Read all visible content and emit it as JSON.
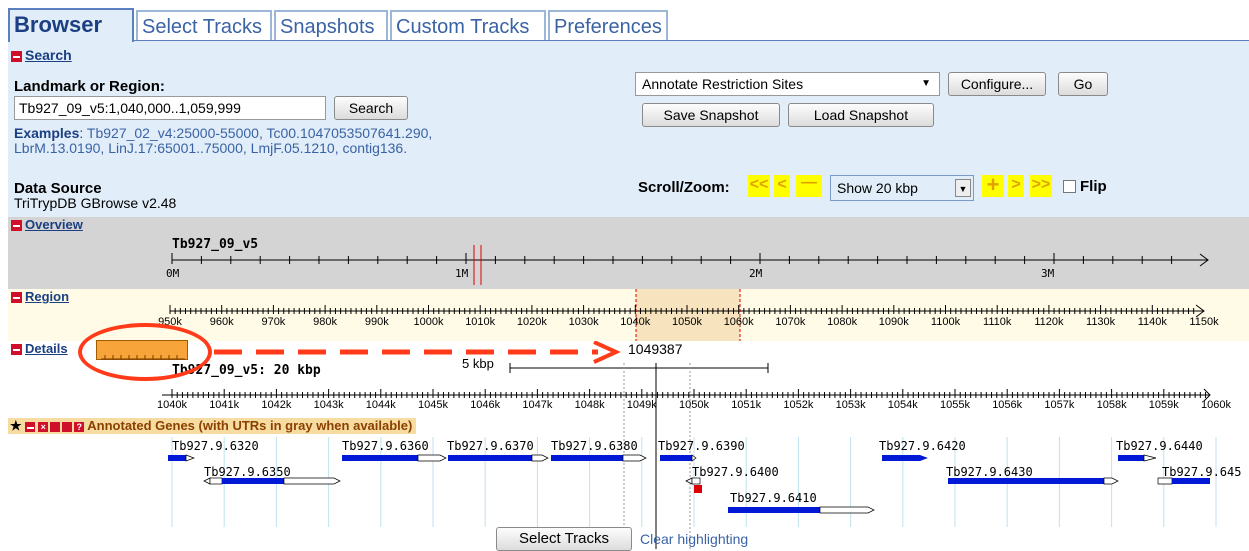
{
  "tabs": [
    {
      "label": "Browser"
    },
    {
      "label": "Select Tracks"
    },
    {
      "label": "Snapshots"
    },
    {
      "label": "Custom Tracks"
    },
    {
      "label": "Preferences"
    }
  ],
  "search": {
    "section": "Search",
    "landmark_label": "Landmark or Region:",
    "value": "Tb927_09_v5:1,040,000..1,059,999",
    "button": "Search",
    "examples_label": "Examples",
    "examples": [
      "Tb927_02_v4:25000-55000",
      "Tc00.1047053507641.290",
      "LbrM.13.0190",
      "LinJ.17:65001..75000",
      "LmjF.05.1210",
      "contig136."
    ]
  },
  "plugin": {
    "selected": "Annotate Restriction Sites",
    "configure": "Configure...",
    "go": "Go",
    "save_snapshot": "Save Snapshot",
    "load_snapshot": "Load Snapshot"
  },
  "datasource": {
    "label": "Data Source",
    "value": "TriTrypDB GBrowse v2.48"
  },
  "scrollzoom": {
    "label": "Scroll/Zoom:",
    "zoom": "Show 20 kbp",
    "flip": "Flip",
    "left_fast": "<<",
    "left": "<",
    "minus": "—",
    "plus": "+",
    "right": ">",
    "right_fast": ">>"
  },
  "overview": {
    "section": "Overview",
    "chrom": "Tb927_09_v5",
    "ticks": [
      "0M",
      "1M",
      "2M",
      "3M"
    ]
  },
  "region": {
    "section": "Region",
    "ticks": [
      "950k",
      "960k",
      "970k",
      "980k",
      "990k",
      "1000k",
      "1010k",
      "1020k",
      "1030k",
      "1040k",
      "1050k",
      "1060k",
      "1070k",
      "1080k",
      "1090k",
      "1100k",
      "1110k",
      "1120k",
      "1130k",
      "1140k",
      "1150k"
    ]
  },
  "details": {
    "section": "Details",
    "position": "1049387",
    "scale": "5 kbp",
    "title": "Tb927_09_v5: 20 kbp",
    "ticks": [
      "1040k",
      "1041k",
      "1042k",
      "1043k",
      "1044k",
      "1045k",
      "1046k",
      "1047k",
      "1048k",
      "1049k",
      "1050k",
      "1051k",
      "1052k",
      "1053k",
      "1054k",
      "1055k",
      "1056k",
      "1057k",
      "1058k",
      "1059k",
      "1060k"
    ]
  },
  "track": {
    "title": "Annotated Genes (with UTRs in gray when available)",
    "genes": [
      "Tb927.9.6320",
      "Tb927.9.6360",
      "Tb927.9.6370",
      "Tb927.9.6380",
      "Tb927.9.6390",
      "Tb927.9.6420",
      "Tb927.9.6440",
      "Tb927.9.6350",
      "Tb927.9.6400",
      "Tb927.9.6430",
      "Tb927.9.645",
      "Tb927.9.6410"
    ]
  },
  "bottom": {
    "select_tracks": "Select Tracks",
    "clear": "Clear highlighting"
  },
  "colors": {
    "accent": "#1b3f82",
    "panel": "#e1edf8",
    "gene": "#0019d6",
    "highlight": "#ff8800",
    "annotation": "#ff3b1a"
  }
}
